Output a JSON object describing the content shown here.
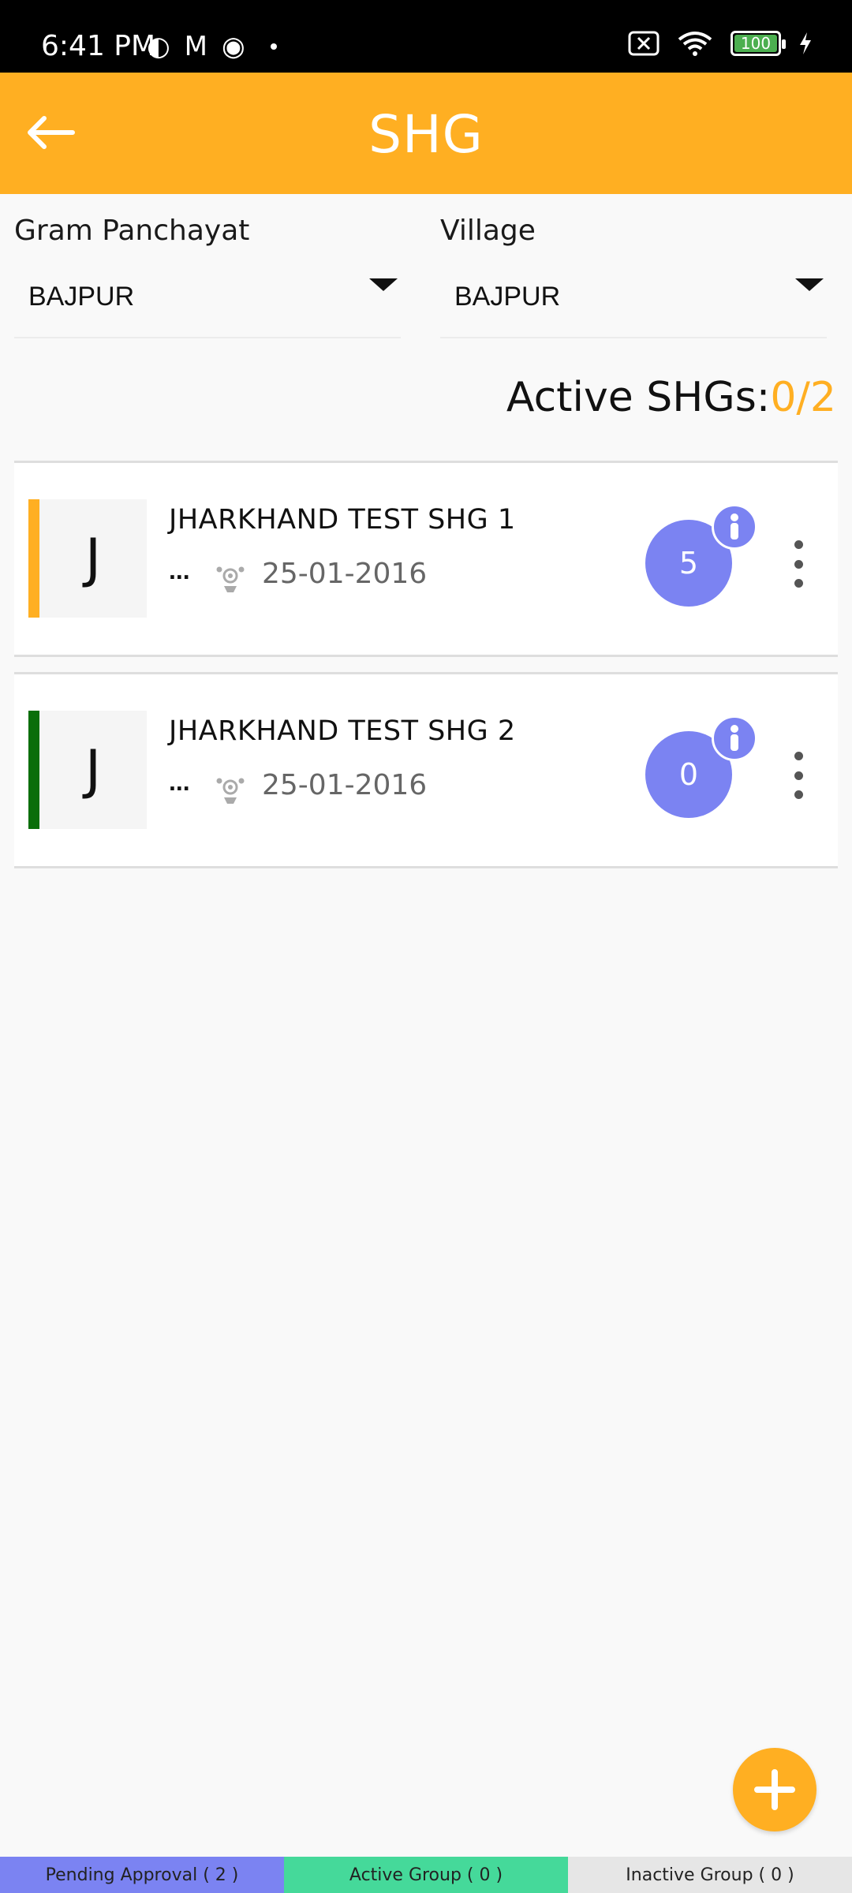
{
  "status_bar": {
    "time": "6:41 PM",
    "battery": "100"
  },
  "app_bar": {
    "title": "SHG"
  },
  "filters": {
    "gram_panchayat": {
      "label": "Gram Panchayat",
      "value": "BAJPUR"
    },
    "village": {
      "label": "Village",
      "value": "BAJPUR"
    }
  },
  "active_shgs": {
    "label": "Active SHGs:",
    "value": "0/2"
  },
  "shg_list": [
    {
      "initial": "J",
      "name": "JHARKHAND TEST SHG 1",
      "ellipsis": "...",
      "date": "25-01-2016",
      "members": "5",
      "stripe_color": "#ffaf22"
    },
    {
      "initial": "J",
      "name": "JHARKHAND TEST SHG 2",
      "ellipsis": "...",
      "date": "25-01-2016",
      "members": "0",
      "stripe_color": "#0a6e0a"
    }
  ],
  "bottom_tabs": [
    {
      "label": "Pending Approval ( 2 )",
      "color": "#7b83f2"
    },
    {
      "label": "Active Group ( 0 )",
      "color": "#45d99a"
    },
    {
      "label": "Inactive Group ( 0 )",
      "color": "#e6e6e6"
    }
  ],
  "colors": {
    "primary": "#ffaf22",
    "badge": "#7b83f2"
  }
}
